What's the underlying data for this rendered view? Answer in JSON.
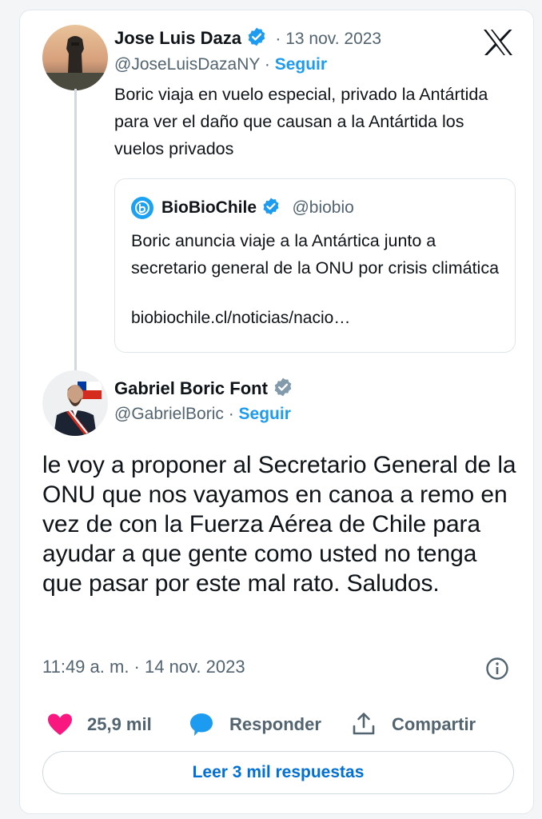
{
  "colors": {
    "accent": "#1d9bf0",
    "like": "#f91880",
    "muted": "#536471"
  },
  "reply_to": {
    "author_name": "Jose Luis Daza",
    "date": "· 13 nov. 2023",
    "handle": "@JoseLuisDazaNY",
    "separator": "·",
    "follow_label": "Seguir",
    "text": "Boric viaja en vuelo especial, privado la Antártida para ver el daño que causan a la Antártida los vuelos privados",
    "quote": {
      "author_name": "BioBioChile",
      "handle": "@biobio",
      "text": "Boric anuncia viaje a la Antártica junto a secretario general de la ONU por crisis climática",
      "link": "biobiochile.cl/noticias/nacio…"
    }
  },
  "tweet": {
    "author_name": "Gabriel Boric Font",
    "handle": "@GabrielBoric",
    "separator": "·",
    "follow_label": "Seguir",
    "text": "le voy a proponer al Secretario General de la ONU que nos vayamos en canoa a remo en vez de con la Fuerza Aérea de Chile para ayudar a que gente como usted no tenga que pasar por este mal rato. Saludos.",
    "timestamp": "11:49 a. m. · 14 nov. 2023"
  },
  "actions": {
    "likes": "25,9 mil",
    "reply_label": "Responder",
    "share_label": "Compartir"
  },
  "read_replies_label": "Leer 3 mil respuestas",
  "icons": [
    "x-logo-icon",
    "verified-badge-icon",
    "verified-gray-badge-icon",
    "biobio-logo-icon",
    "info-icon",
    "heart-icon",
    "reply-bubble-icon",
    "share-icon"
  ]
}
